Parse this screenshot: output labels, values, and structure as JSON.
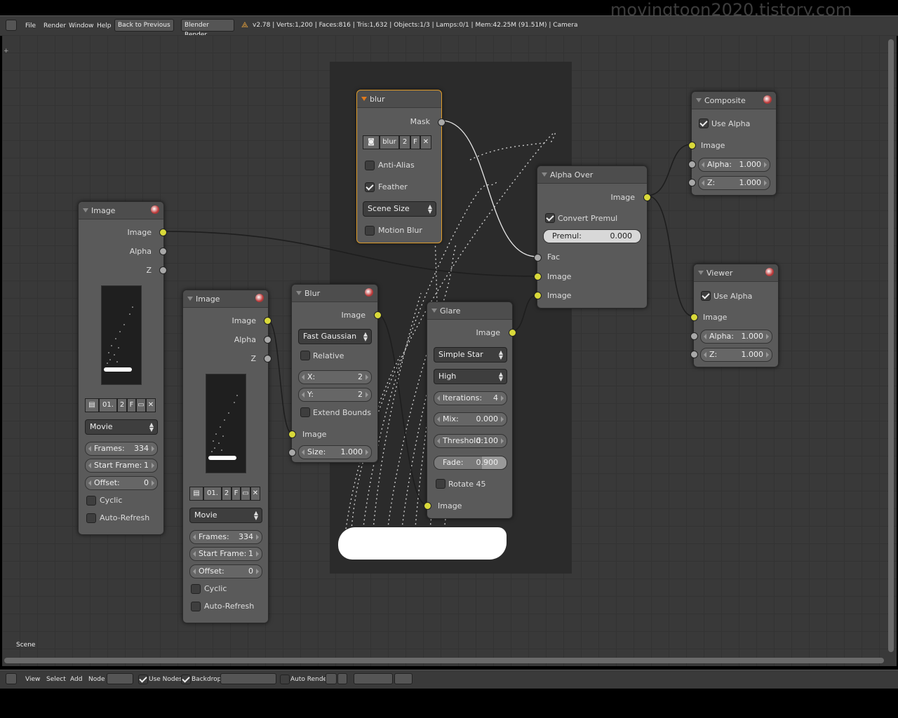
{
  "watermark": "movingtoon2020.tistory.com",
  "topbar": {
    "menu": [
      "File",
      "Render",
      "Window",
      "Help"
    ],
    "back_button": "Back to Previous",
    "render_engine": "Blender Render",
    "status": "v2.78 | Verts:1,200 | Faces:816 | Tris:1,632 | Objects:1/3 | Lamps:0/1 | Mem:42.25M (91.51M) | Camera"
  },
  "scene_label": "Scene",
  "bottombar": {
    "menu": [
      "View",
      "Select",
      "Add",
      "Node"
    ],
    "use_nodes": "Use Nodes",
    "backdrop": "Backdrop",
    "auto_render": "Auto Render"
  },
  "nodes": {
    "image1": {
      "title": "Image",
      "outputs": [
        "Image",
        "Alpha",
        "Z"
      ],
      "bar": {
        "name": "01.",
        "users": "2",
        "fake": "F"
      },
      "source": "Movie",
      "frames_label": "Frames:",
      "frames": "334",
      "start_label": "Start Frame:",
      "start": "1",
      "offset_label": "Offset:",
      "offset": "0",
      "cyclic": "Cyclic",
      "auto_refresh": "Auto-Refresh"
    },
    "image2": {
      "title": "Image",
      "outputs": [
        "Image",
        "Alpha",
        "Z"
      ],
      "bar": {
        "name": "01.",
        "users": "2",
        "fake": "F"
      },
      "source": "Movie",
      "frames_label": "Frames:",
      "frames": "334",
      "start_label": "Start Frame:",
      "start": "1",
      "offset_label": "Offset:",
      "offset": "0",
      "cyclic": "Cyclic",
      "auto_refresh": "Auto-Refresh"
    },
    "mask": {
      "title": "blur",
      "output": "Mask",
      "bar": {
        "name": "blur",
        "users": "2",
        "fake": "F"
      },
      "anti_alias": "Anti-Alias",
      "feather": "Feather",
      "size_mode": "Scene Size",
      "motion_blur": "Motion Blur"
    },
    "blur": {
      "title": "Blur",
      "output": "Image",
      "filter": "Fast Gaussian",
      "relative": "Relative",
      "x_label": "X:",
      "x": "2",
      "y_label": "Y:",
      "y": "2",
      "extend_bounds": "Extend Bounds",
      "input": "Image",
      "size_label": "Size:",
      "size": "1.000"
    },
    "glare": {
      "title": "Glare",
      "output": "Image",
      "glare_type": "Simple Star",
      "quality": "High",
      "iterations_label": "Iterations:",
      "iterations": "4",
      "mix_label": "Mix:",
      "mix": "0.000",
      "threshold_label": "Threshold:",
      "threshold": "0.100",
      "fade_label": "Fade:",
      "fade": "0.900",
      "rotate45": "Rotate 45",
      "input": "Image"
    },
    "alpha_over": {
      "title": "Alpha Over",
      "output": "Image",
      "convert_premul": "Convert Premul",
      "premul_label": "Premul:",
      "premul": "0.000",
      "inputs": [
        "Fac",
        "Image",
        "Image"
      ]
    },
    "composite": {
      "title": "Composite",
      "use_alpha": "Use Alpha",
      "input": "Image",
      "alpha_label": "Alpha:",
      "alpha": "1.000",
      "z_label": "Z:",
      "z": "1.000"
    },
    "viewer": {
      "title": "Viewer",
      "use_alpha": "Use Alpha",
      "input": "Image",
      "alpha_label": "Alpha:",
      "alpha": "1.000",
      "z_label": "Z:",
      "z": "1.000"
    }
  },
  "colors": {
    "socket_image": "#d9d93a",
    "socket_value": "#a8a8a8",
    "selected_border": "#e09c2a"
  }
}
